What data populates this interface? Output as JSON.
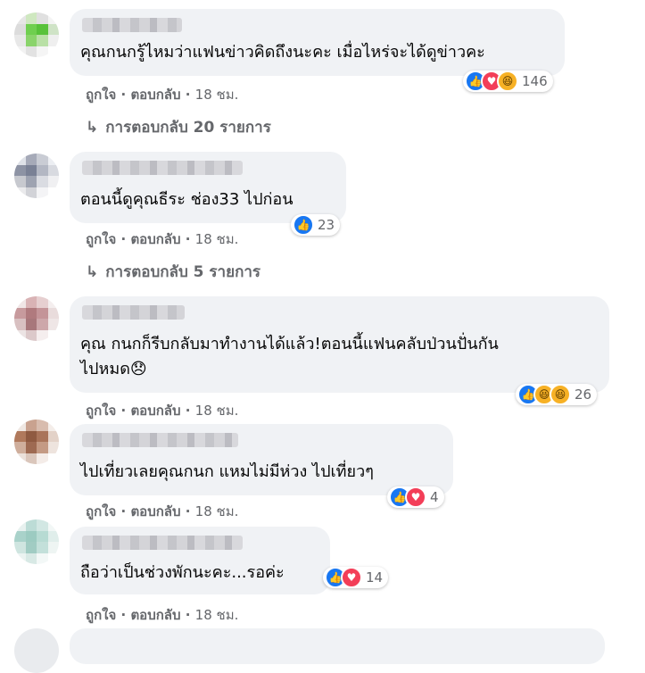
{
  "comments": [
    {
      "text": "คุณกนกรู้ไหมว่าแฟนข่าวคิดถึงนะคะ เมื่อไหร่จะได้ดูข่าวคะ",
      "reactions": [
        "like",
        "love",
        "haha"
      ],
      "count": "146",
      "like": "ถูกใจ",
      "reply": "ตอบกลับ",
      "time": "18 ชม.",
      "replies": "การตอบกลับ 20 รายการ",
      "avatar_colors": [
        "#e6e6e6",
        "#cfe8c0",
        "#e0e0e0",
        "#f4f4f4",
        "#dcdcdc",
        "#6fcf4f",
        "#58c23a",
        "#cfe3c6",
        "#e8e8e8",
        "#8ad46b",
        "#b9e0a6",
        "#efefef",
        "#f2f2f2",
        "#e2e2e2",
        "#f5f5f5",
        "#ffffff"
      ]
    },
    {
      "text": "ตอนนี้ดูคุณธีระ ช่อง33 ไปก่อน",
      "reactions": [
        "like"
      ],
      "count": "23",
      "like": "ถูกใจ",
      "reply": "ตอบกลับ",
      "time": "18 ชม.",
      "replies": "การตอบกลับ 5 รายการ",
      "avatar_colors": [
        "#dfe2e8",
        "#a6aab8",
        "#c9ccd4",
        "#eceef2",
        "#8d93a4",
        "#7a8195",
        "#b3b7c3",
        "#d8dae0",
        "#c7c9cf",
        "#9ea3b1",
        "#dadce2",
        "#f0f0f2",
        "#eaeaec",
        "#d2d3d8",
        "#f4f4f6",
        "#ffffff"
      ]
    },
    {
      "text": "คุณ กนกก็รีบกลับมาทำงานได้แล้ว!ตอนนี้แฟนคลับป่วนปั่นกัน\nไปหมด😞",
      "reactions": [
        "like",
        "haha",
        "haha"
      ],
      "count": "26",
      "like": "ถูกใจ",
      "reply": "ตอบกลับ",
      "time": "18 ชม.",
      "avatar_colors": [
        "#f0e6e6",
        "#d9b3b5",
        "#e6cfd0",
        "#f4eeee",
        "#c79a9d",
        "#b07a7e",
        "#c49498",
        "#e9dcdc",
        "#d8c0c1",
        "#a8777b",
        "#cda7aa",
        "#efe6e6",
        "#ece4e4",
        "#dcc9ca",
        "#f5eeee",
        "#ffffff"
      ]
    },
    {
      "text": "ไปเที่ยวเลยคุณกนก แหมไม่มีห่วง ไปเที่ยวๆ",
      "reactions": [
        "like",
        "love"
      ],
      "count": "4",
      "like": "ถูกใจ",
      "reply": "ตอบกลับ",
      "time": "18 ชม.",
      "avatar_colors": [
        "#efe7e2",
        "#c9a28f",
        "#d8bcae",
        "#f4ede9",
        "#b0795c",
        "#8f5a41",
        "#a9745a",
        "#e3d2c8",
        "#cfae9c",
        "#9e6a52",
        "#c49a84",
        "#eee4de",
        "#ebe1db",
        "#dac6bb",
        "#f4ece8",
        "#ffffff"
      ]
    },
    {
      "text": "ถือว่าเป็นช่วงพักนะคะ...รอค่ะ",
      "reactions": [
        "like",
        "love"
      ],
      "count": "14",
      "like": "ถูกใจ",
      "reply": "ตอบกลับ",
      "time": "18 ชม.",
      "avatar_colors": [
        "#e7f1ef",
        "#bcdcd6",
        "#d2e7e3",
        "#f2f7f6",
        "#a9d2ca",
        "#9ccbc1",
        "#b7dbd3",
        "#e0eeeb",
        "#cfe5e0",
        "#a1ccc3",
        "#c3e0da",
        "#eef5f3",
        "#ebf3f1",
        "#d8e9e5",
        "#f3f8f7",
        "#ffffff"
      ]
    }
  ]
}
